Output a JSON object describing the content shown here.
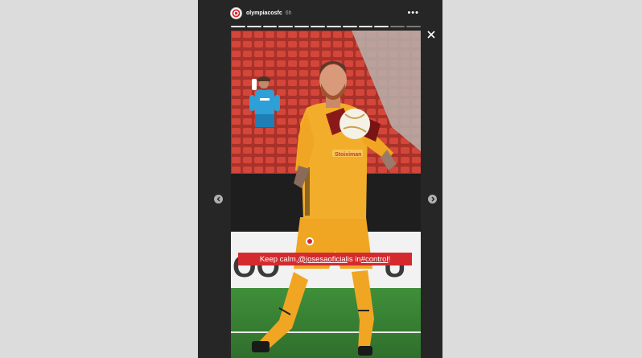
{
  "post": {
    "username": "olympiacosfc",
    "timestamp": "6h"
  },
  "progress": {
    "segments_total": 12,
    "segments_done": 10
  },
  "caption": {
    "prefix": "Keep calm, ",
    "mention": "@josesaoficial",
    "middle": " is in ",
    "hashtag": "#control",
    "suffix": "!"
  },
  "colors": {
    "viewer_bg": "#262626",
    "page_bg": "#dcdcdc",
    "caption_bg": "#d42a2e",
    "kit_orange": "#f0a623",
    "seats_red": "#c0392b"
  },
  "icons": {
    "more": "more-options-icon",
    "close": "close-icon",
    "prev": "chevron-left-icon",
    "next": "chevron-right-icon"
  }
}
